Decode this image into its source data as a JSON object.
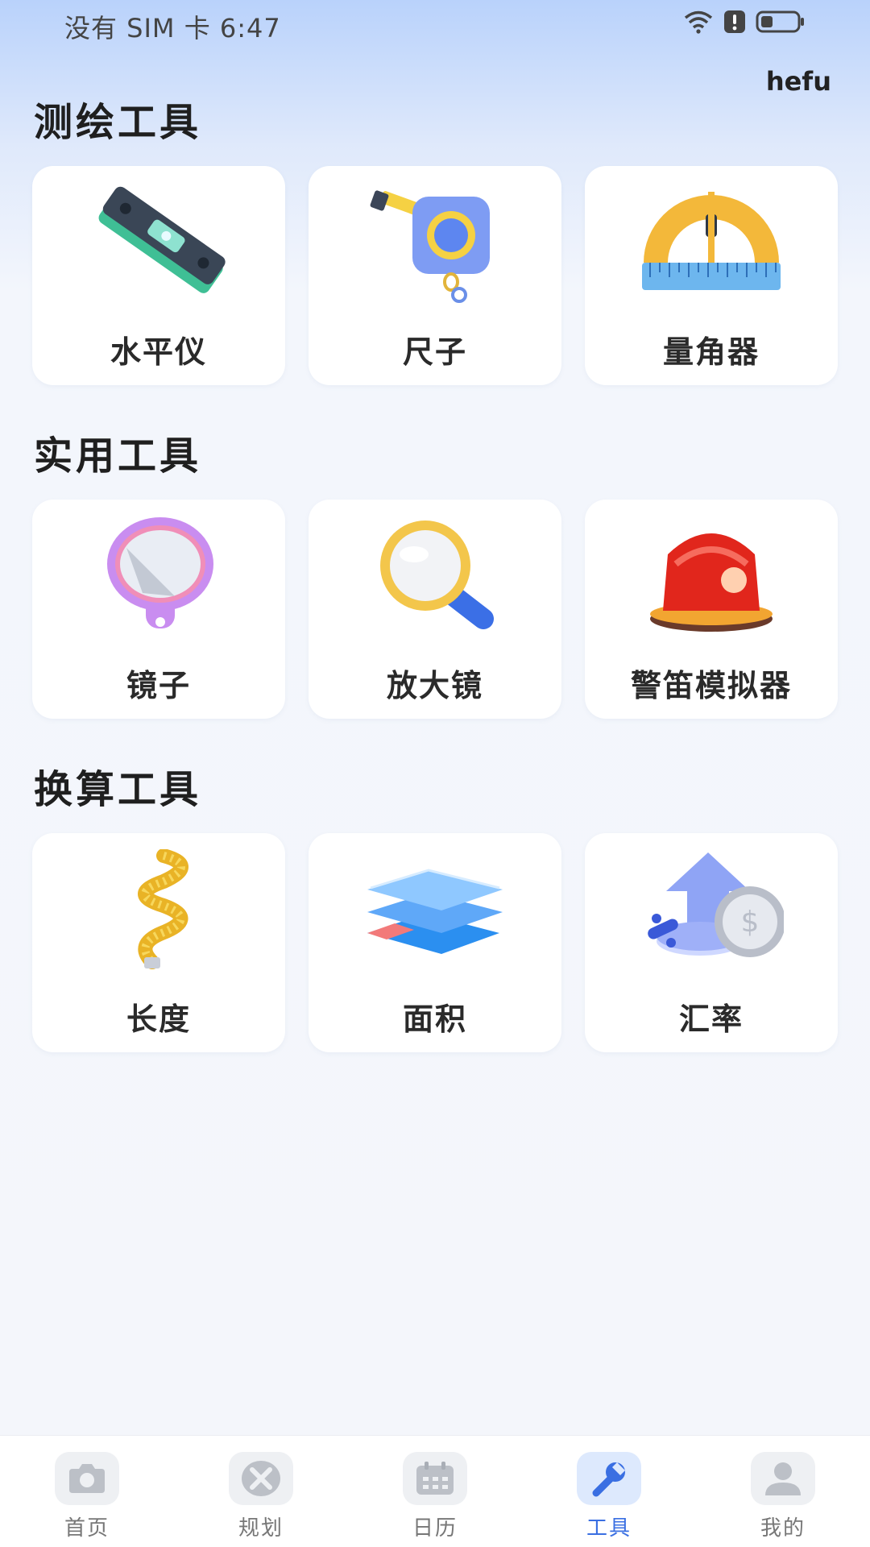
{
  "status_bar": {
    "text": "没有 SIM 卡 6:47"
  },
  "brand": "hefu",
  "sections": [
    {
      "title": "测绘工具",
      "tools": [
        {
          "label": "水平仪",
          "icon": "spirit-level-icon"
        },
        {
          "label": "尺子",
          "icon": "tape-measure-icon"
        },
        {
          "label": "量角器",
          "icon": "protractor-icon"
        }
      ]
    },
    {
      "title": "实用工具",
      "tools": [
        {
          "label": "镜子",
          "icon": "hand-mirror-icon"
        },
        {
          "label": "放大镜",
          "icon": "magnifier-icon"
        },
        {
          "label": "警笛模拟器",
          "icon": "siren-icon"
        }
      ]
    },
    {
      "title": "换算工具",
      "tools": [
        {
          "label": "长度",
          "icon": "measuring-tape-roll-icon"
        },
        {
          "label": "面积",
          "icon": "layers-icon"
        },
        {
          "label": "汇率",
          "icon": "exchange-rate-coin-icon"
        }
      ]
    }
  ],
  "tabbar": {
    "active": "工具",
    "tabs": [
      {
        "label": "首页",
        "icon": "camera-icon"
      },
      {
        "label": "规划",
        "icon": "tools-cross-icon"
      },
      {
        "label": "日历",
        "icon": "calendar-icon"
      },
      {
        "label": "工具",
        "icon": "wrench-icon"
      },
      {
        "label": "我的",
        "icon": "person-icon"
      }
    ]
  },
  "colors": {
    "accent": "#3a6fe2",
    "background": "#f4f6fb",
    "card": "#ffffff"
  }
}
